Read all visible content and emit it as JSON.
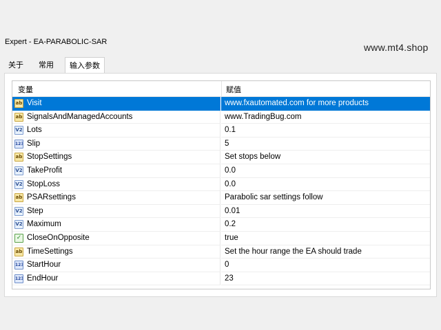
{
  "window": {
    "title": "Expert - EA-PARABOLIC-SAR"
  },
  "watermark": "www.mt4.shop",
  "tabs": [
    {
      "label": "关于"
    },
    {
      "label": "常用"
    },
    {
      "label": "输入参数",
      "active": true
    }
  ],
  "table": {
    "headers": {
      "variable": "变量",
      "value": "赋值"
    },
    "rows": [
      {
        "name": "Visit",
        "value": "www.fxautomated.com for more products",
        "icon": "string-icon",
        "selected": true
      },
      {
        "name": "SignalsAndManagedAccounts",
        "value": "www.TradingBug.com",
        "icon": "string-icon"
      },
      {
        "name": "Lots",
        "value": "0.1",
        "icon": "double-icon"
      },
      {
        "name": "Slip",
        "value": "5",
        "icon": "integer-icon"
      },
      {
        "name": "StopSettings",
        "value": "Set stops below",
        "icon": "string-icon"
      },
      {
        "name": "TakeProfit",
        "value": "0.0",
        "icon": "double-icon"
      },
      {
        "name": "StopLoss",
        "value": "0.0",
        "icon": "double-icon"
      },
      {
        "name": "PSARsettings",
        "value": "Parabolic sar settings follow",
        "icon": "string-icon"
      },
      {
        "name": "Step",
        "value": "0.01",
        "icon": "double-icon"
      },
      {
        "name": "Maximum",
        "value": "0.2",
        "icon": "double-icon"
      },
      {
        "name": "CloseOnOpposite",
        "value": "true",
        "icon": "bool-icon"
      },
      {
        "name": "TimeSettings",
        "value": "Set the hour range the EA should trade",
        "icon": "string-icon"
      },
      {
        "name": "StartHour",
        "value": "0",
        "icon": "integer-icon"
      },
      {
        "name": "EndHour",
        "value": "23",
        "icon": "integer-icon"
      }
    ]
  },
  "icon_glyphs": {
    "string-icon": "ab",
    "integer-icon": "123",
    "double-icon": "V2",
    "bool-icon": "✓"
  },
  "colors": {
    "selection": "#0078d7",
    "window_bg": "#f0f0f0"
  }
}
